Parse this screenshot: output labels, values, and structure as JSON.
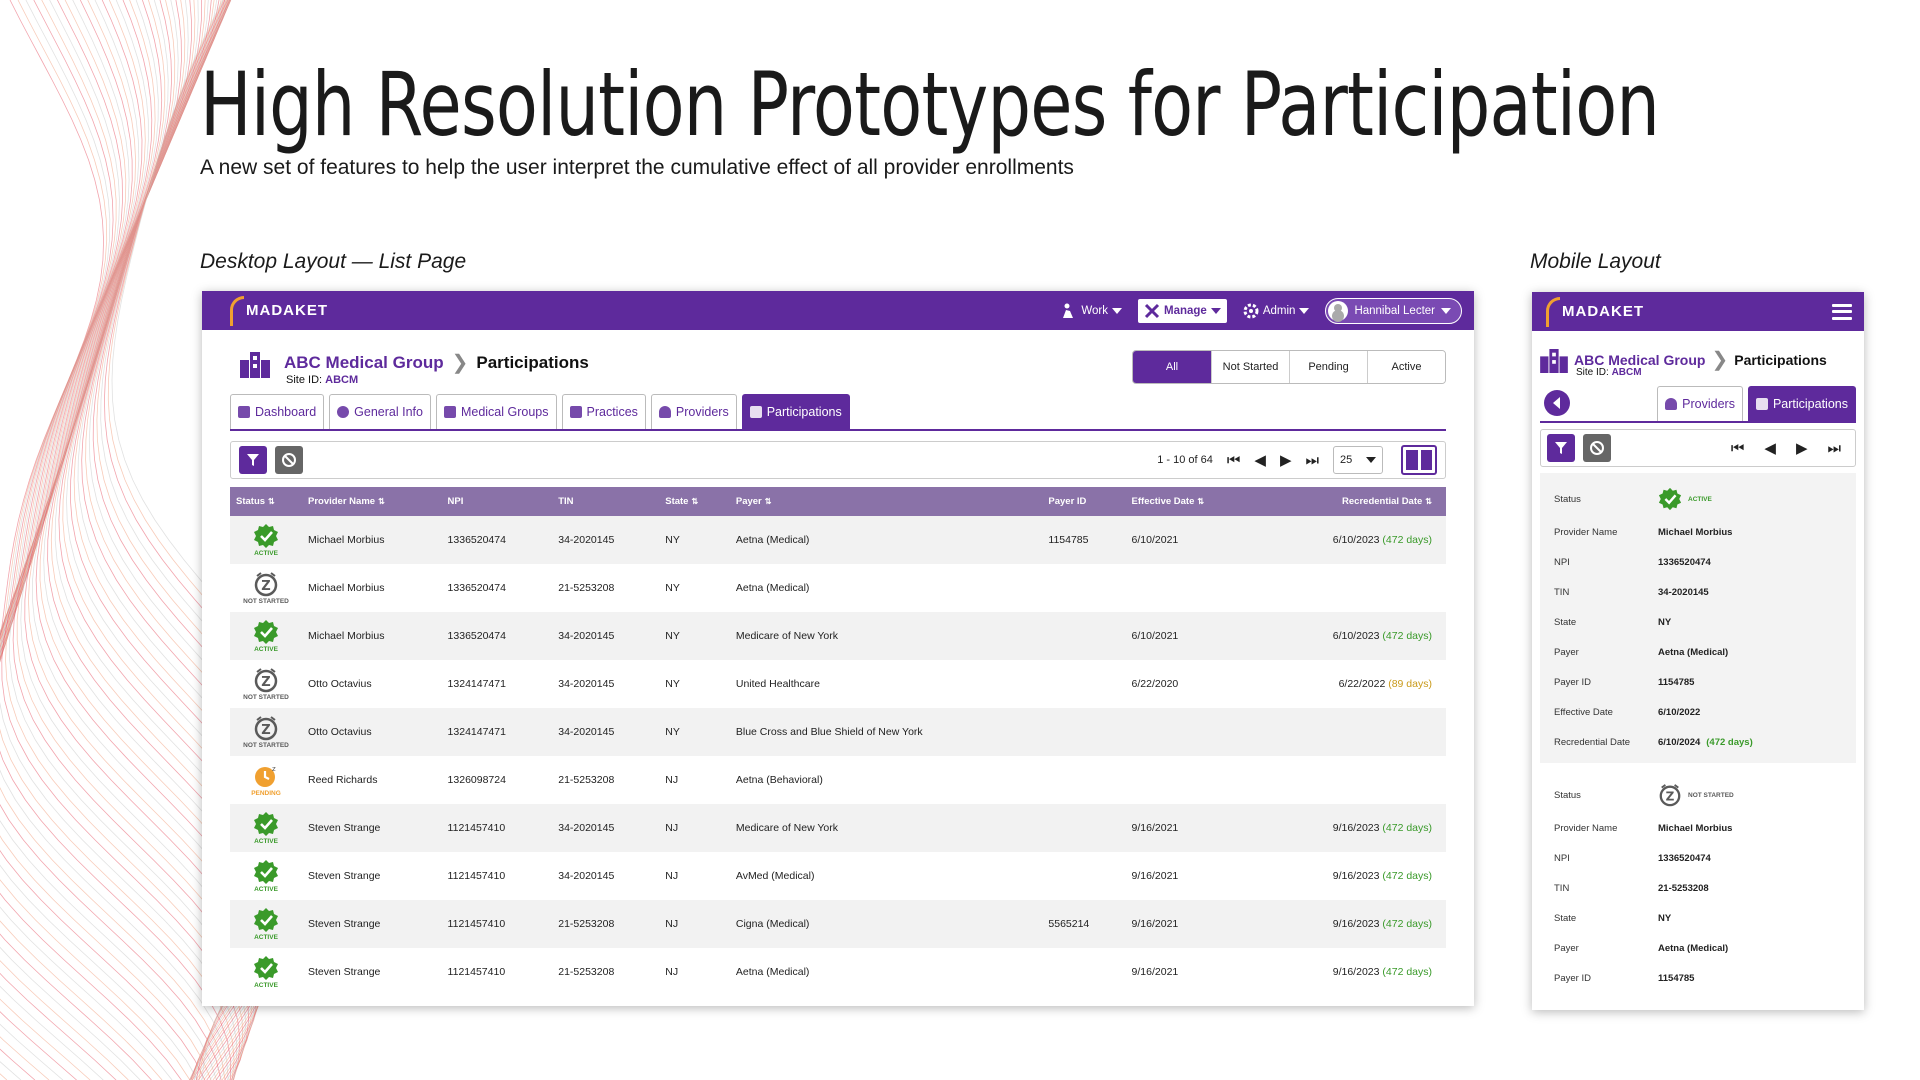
{
  "slide": {
    "title": "High Resolution Prototypes for Participation",
    "subtitle": "A new set of features to help the user interpret the cumulative effect of all provider enrollments",
    "desktop_caption": "Desktop Layout — List Page",
    "mobile_caption": "Mobile Layout"
  },
  "brand": {
    "name": "MADAKET",
    "purple": "#5e2a9c",
    "accent": "#f0a030"
  },
  "nav": {
    "work": "Work",
    "manage": "Manage",
    "admin": "Admin",
    "user": "Hannibal Lecter"
  },
  "breadcrumb": {
    "org": "ABC Medical Group",
    "page": "Participations",
    "site_id_label": "Site ID:",
    "site_id": "ABCM"
  },
  "filters": [
    "All",
    "Not Started",
    "Pending",
    "Active"
  ],
  "tabs": [
    "Dashboard",
    "General Info",
    "Medical Groups",
    "Practices",
    "Providers",
    "Participations"
  ],
  "pager": {
    "range": "1 - 10 of 64",
    "page_size": "25"
  },
  "table": {
    "headers": [
      "Status",
      "Provider Name",
      "NPI",
      "TIN",
      "State",
      "Payer",
      "Payer ID",
      "Effective Date",
      "Recredential Date"
    ],
    "rows": [
      {
        "status": "ACTIVE",
        "name": "Michael Morbius",
        "npi": "1336520474",
        "tin": "34-2020145",
        "state": "NY",
        "payer": "Aetna (Medical)",
        "payer_id": "1154785",
        "eff": "6/10/2021",
        "recred": "6/10/2023",
        "days": "(472 days)"
      },
      {
        "status": "NOT STARTED",
        "name": "Michael Morbius",
        "npi": "1336520474",
        "tin": "21-5253208",
        "state": "NY",
        "payer": "Aetna (Medical)",
        "payer_id": "",
        "eff": "",
        "recred": "",
        "days": ""
      },
      {
        "status": "ACTIVE",
        "name": "Michael Morbius",
        "npi": "1336520474",
        "tin": "34-2020145",
        "state": "NY",
        "payer": "Medicare of New York",
        "payer_id": "",
        "eff": "6/10/2021",
        "recred": "6/10/2023",
        "days": "(472 days)"
      },
      {
        "status": "NOT STARTED",
        "name": "Otto Octavius",
        "npi": "1324147471",
        "tin": "34-2020145",
        "state": "NY",
        "payer": "United Healthcare",
        "payer_id": "",
        "eff": "6/22/2020",
        "recred": "6/22/2022",
        "days": "(89 days)"
      },
      {
        "status": "NOT STARTED",
        "name": "Otto Octavius",
        "npi": "1324147471",
        "tin": "34-2020145",
        "state": "NY",
        "payer": "Blue Cross and Blue Shield of New York",
        "payer_id": "",
        "eff": "",
        "recred": "",
        "days": ""
      },
      {
        "status": "PENDING",
        "name": "Reed Richards",
        "npi": "1326098724",
        "tin": "21-5253208",
        "state": "NJ",
        "payer": "Aetna (Behavioral)",
        "payer_id": "",
        "eff": "",
        "recred": "",
        "days": ""
      },
      {
        "status": "ACTIVE",
        "name": "Steven Strange",
        "npi": "1121457410",
        "tin": "34-2020145",
        "state": "NJ",
        "payer": "Medicare of New York",
        "payer_id": "",
        "eff": "9/16/2021",
        "recred": "9/16/2023",
        "days": "(472 days)"
      },
      {
        "status": "ACTIVE",
        "name": "Steven Strange",
        "npi": "1121457410",
        "tin": "34-2020145",
        "state": "NJ",
        "payer": "AvMed (Medical)",
        "payer_id": "",
        "eff": "9/16/2021",
        "recred": "9/16/2023",
        "days": "(472 days)"
      },
      {
        "status": "ACTIVE",
        "name": "Steven Strange",
        "npi": "1121457410",
        "tin": "21-5253208",
        "state": "NJ",
        "payer": "Cigna (Medical)",
        "payer_id": "5565214",
        "eff": "9/16/2021",
        "recred": "9/16/2023",
        "days": "(472 days)"
      },
      {
        "status": "ACTIVE",
        "name": "Steven Strange",
        "npi": "1121457410",
        "tin": "21-5253208",
        "state": "NJ",
        "payer": "Aetna (Medical)",
        "payer_id": "",
        "eff": "9/16/2021",
        "recred": "9/16/2023",
        "days": "(472 days)"
      }
    ]
  },
  "mobile": {
    "tabs": [
      "Providers",
      "Participations"
    ],
    "labels": [
      "Status",
      "Provider Name",
      "NPI",
      "TIN",
      "State",
      "Payer",
      "Payer ID",
      "Effective Date",
      "Recredential Date"
    ],
    "cards": [
      {
        "status": "ACTIVE",
        "name": "Michael Morbius",
        "npi": "1336520474",
        "tin": "34-2020145",
        "state": "NY",
        "payer": "Aetna (Medical)",
        "payer_id": "1154785",
        "eff": "6/10/2022",
        "recred": "6/10/2024",
        "days": "(472 days)"
      },
      {
        "status": "NOT STARTED",
        "name": "Michael Morbius",
        "npi": "1336520474",
        "tin": "21-5253208",
        "state": "NY",
        "payer": "Aetna (Medical)",
        "payer_id": "1154785"
      }
    ]
  },
  "status_colors": {
    "ACTIVE": "#3a9a2a",
    "NOT STARTED": "#5a5a5a",
    "PENDING": "#f0a030"
  }
}
